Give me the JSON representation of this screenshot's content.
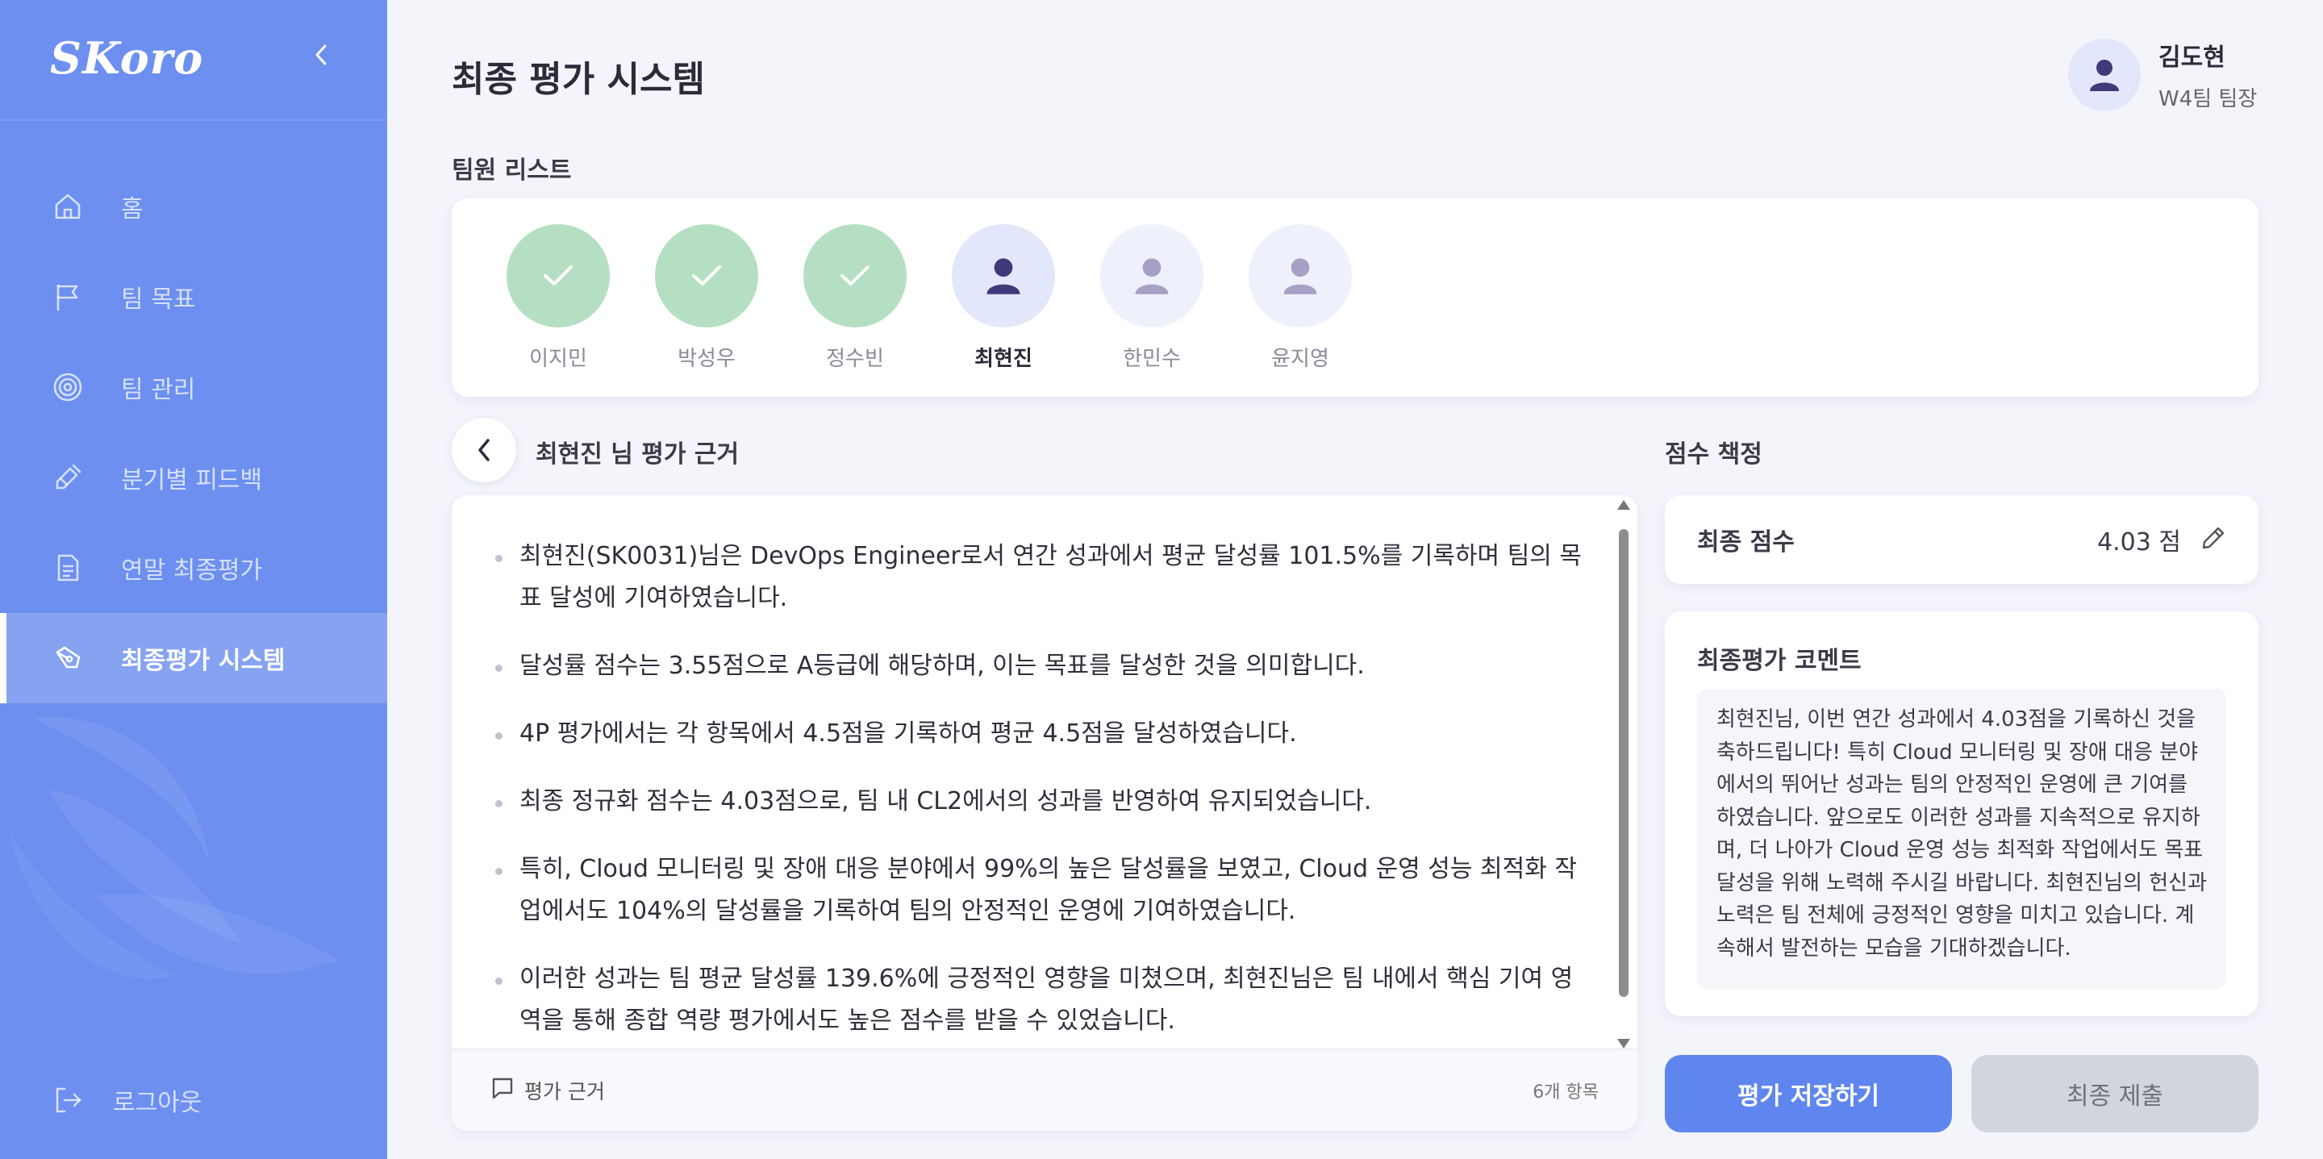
{
  "app": {
    "logo": "SKoro",
    "page_title": "최종 평가 시스템"
  },
  "sidebar": {
    "items": [
      {
        "label": "홈",
        "icon": "home-icon"
      },
      {
        "label": "팀 목표",
        "icon": "flag-icon"
      },
      {
        "label": "팀 관리",
        "icon": "target-icon"
      },
      {
        "label": "분기별 피드백",
        "icon": "wrench-icon"
      },
      {
        "label": "연말 최종평가",
        "icon": "document-icon"
      },
      {
        "label": "최종평가 시스템",
        "icon": "pen-tool-icon",
        "active": true
      }
    ],
    "logout": "로그아웃"
  },
  "user": {
    "name": "김도현",
    "role": "W4팀 팀장"
  },
  "team": {
    "label": "팀원 리스트",
    "members": [
      {
        "name": "이지민",
        "status": "done"
      },
      {
        "name": "박성우",
        "status": "done"
      },
      {
        "name": "정수빈",
        "status": "done"
      },
      {
        "name": "최현진",
        "status": "current"
      },
      {
        "name": "한민수",
        "status": "pending"
      },
      {
        "name": "윤지영",
        "status": "pending"
      }
    ]
  },
  "evaluation": {
    "title": "최현진 님 평가 근거",
    "items": [
      "최현진(SK0031)님은 DevOps Engineer로서 연간 성과에서 평균 달성률 101.5%를 기록하며 팀의 목표 달성에 기여하였습니다.",
      "달성률 점수는 3.55점으로 A등급에 해당하며, 이는 목표를 달성한 것을 의미합니다.",
      "4P 평가에서는 각 항목에서 4.5점을 기록하여 평균 4.5점을 달성하였습니다.",
      "최종 정규화 점수는 4.03점으로, 팀 내 CL2에서의 성과를 반영하여 유지되었습니다.",
      "특히, Cloud 모니터링 및 장애 대응 분야에서 99%의 높은 달성률을 보였고, Cloud 운영 성능 최적화 작업에서도 104%의 달성률을 기록하여 팀의 안정적인 운영에 기여하였습니다.",
      "이러한 성과는 팀 평균 달성률 139.6%에 긍정적인 영향을 미쳤으며, 최현진님은 팀 내에서 핵심 기여 영역을 통해 종합 역량 평가에서도 높은 점수를 받을 수 있었습니다."
    ],
    "footer_label": "평가 근거",
    "count_label": "6개 항목"
  },
  "scoring": {
    "label": "점수 책정",
    "final_score_label": "최종 점수",
    "final_score_value": "4.03 점",
    "comment_title": "최종평가 코멘트",
    "comment_text": "최현진님, 이번 연간 성과에서 4.03점을 기록하신 것을 축하드립니다! 특히 Cloud 모니터링 및 장애 대응 분야에서의 뛰어난 성과는 팀의 안정적인 운영에 큰 기여를 하였습니다. 앞으로도 이러한 성과를 지속적으로 유지하며, 더 나아가 Cloud 운영 성능 최적화 작업에서도 목표 달성을 위해 노력해 주시길 바랍니다. 최현진님의 헌신과 노력은 팀 전체에 긍정적인 영향을 미치고 있습니다. 계속해서 발전하는 모습을 기대하겠습니다."
  },
  "actions": {
    "save": "평가 저장하기",
    "submit": "최종 제출"
  },
  "colors": {
    "sidebar": "#6c8ff0",
    "primary": "#5f86ee",
    "done": "#b5dfc2",
    "background": "#f4f5fb"
  }
}
